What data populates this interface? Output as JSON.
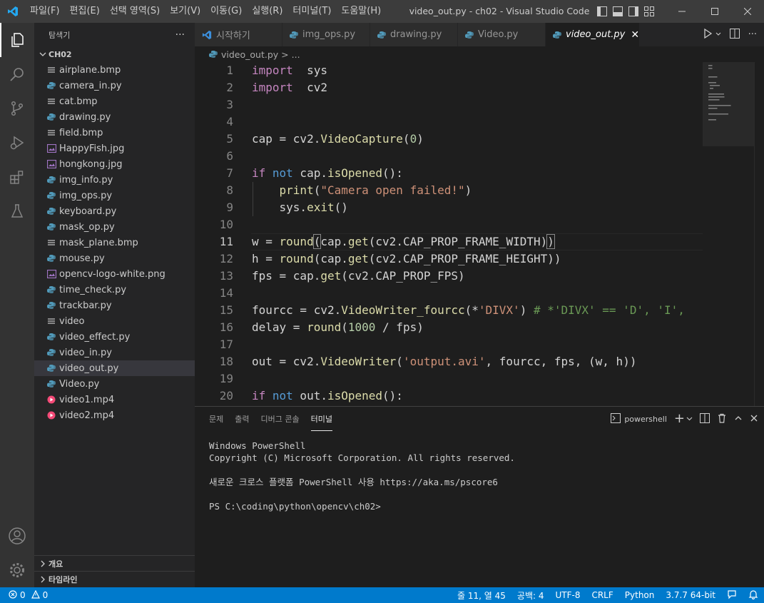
{
  "menu": [
    "파일(F)",
    "편집(E)",
    "선택 영역(S)",
    "보기(V)",
    "이동(G)",
    "실행(R)",
    "터미널(T)",
    "도움말(H)"
  ],
  "window_title": "video_out.py - ch02 - Visual Studio Code",
  "sidebar": {
    "title": "탐색기",
    "more": "···",
    "folder": "CH02",
    "files": [
      {
        "name": "airplane.bmp",
        "type": "plain"
      },
      {
        "name": "camera_in.py",
        "type": "python"
      },
      {
        "name": "cat.bmp",
        "type": "plain"
      },
      {
        "name": "drawing.py",
        "type": "python"
      },
      {
        "name": "field.bmp",
        "type": "plain"
      },
      {
        "name": "HappyFish.jpg",
        "type": "image"
      },
      {
        "name": "hongkong.jpg",
        "type": "image"
      },
      {
        "name": "img_info.py",
        "type": "python"
      },
      {
        "name": "img_ops.py",
        "type": "python"
      },
      {
        "name": "keyboard.py",
        "type": "python"
      },
      {
        "name": "mask_op.py",
        "type": "python"
      },
      {
        "name": "mask_plane.bmp",
        "type": "plain"
      },
      {
        "name": "mouse.py",
        "type": "python"
      },
      {
        "name": "opencv-logo-white.png",
        "type": "image"
      },
      {
        "name": "time_check.py",
        "type": "python"
      },
      {
        "name": "trackbar.py",
        "type": "python"
      },
      {
        "name": "video",
        "type": "plain"
      },
      {
        "name": "video_effect.py",
        "type": "python"
      },
      {
        "name": "video_in.py",
        "type": "python"
      },
      {
        "name": "video_out.py",
        "type": "python"
      },
      {
        "name": "Video.py",
        "type": "python"
      },
      {
        "name": "video1.mp4",
        "type": "video"
      },
      {
        "name": "video2.mp4",
        "type": "video"
      }
    ],
    "selected_file": "video_out.py",
    "outline": "개요",
    "timeline": "타임라인"
  },
  "tabs": [
    {
      "label": "시작하기",
      "icon": "vscode-logo-icon",
      "active": false
    },
    {
      "label": "img_ops.py",
      "icon": "python-file-icon",
      "active": false
    },
    {
      "label": "drawing.py",
      "icon": "python-file-icon",
      "active": false
    },
    {
      "label": "Video.py",
      "icon": "python-file-icon",
      "active": false
    },
    {
      "label": "video_out.py",
      "icon": "python-file-icon",
      "active": true
    }
  ],
  "breadcrumb": {
    "file": "video_out.py",
    "trail": ">",
    "ellipsis": "..."
  },
  "editor": {
    "current_line": 11,
    "lines": [
      {
        "n": "1",
        "tokens": [
          [
            "kwc",
            "import"
          ],
          [
            "",
            "  sys"
          ]
        ]
      },
      {
        "n": "2",
        "tokens": [
          [
            "kwc",
            "import"
          ],
          [
            "",
            "  cv2"
          ]
        ]
      },
      {
        "n": "3",
        "tokens": []
      },
      {
        "n": "4",
        "tokens": []
      },
      {
        "n": "5",
        "tokens": [
          [
            "",
            "cap = cv2."
          ],
          [
            "fn",
            "VideoCapture"
          ],
          [
            "",
            "("
          ],
          [
            "num",
            "0"
          ],
          [
            "",
            ")"
          ]
        ]
      },
      {
        "n": "6",
        "tokens": []
      },
      {
        "n": "7",
        "tokens": [
          [
            "kwc",
            "if"
          ],
          [
            "",
            ""
          ],
          [
            "kw",
            " not"
          ],
          [
            "",
            " cap."
          ],
          [
            "fn",
            "isOpened"
          ],
          [
            "",
            "():"
          ]
        ]
      },
      {
        "n": "8",
        "tokens": [
          [
            "",
            "    "
          ],
          [
            "fn",
            "print"
          ],
          [
            "",
            "("
          ],
          [
            "str",
            "\"Camera open failed!\""
          ],
          [
            "",
            ")"
          ]
        ]
      },
      {
        "n": "9",
        "tokens": [
          [
            "",
            "    sys."
          ],
          [
            "fn",
            "exit"
          ],
          [
            "",
            "()"
          ]
        ]
      },
      {
        "n": "10",
        "tokens": []
      },
      {
        "n": "11",
        "tokens": [
          [
            "",
            "w = "
          ],
          [
            "fn",
            "round"
          ],
          [
            "hl",
            "("
          ],
          [
            "",
            "cap."
          ],
          [
            "fn",
            "get"
          ],
          [
            "",
            "(cv2.CAP_PROP_FRAME_WIDTH)"
          ],
          [
            "hl",
            ")"
          ]
        ]
      },
      {
        "n": "12",
        "tokens": [
          [
            "",
            "h = "
          ],
          [
            "fn",
            "round"
          ],
          [
            "",
            "(cap."
          ],
          [
            "fn",
            "get"
          ],
          [
            "",
            "(cv2.CAP_PROP_FRAME_HEIGHT))"
          ]
        ]
      },
      {
        "n": "13",
        "tokens": [
          [
            "",
            "fps = cap."
          ],
          [
            "fn",
            "get"
          ],
          [
            "",
            "(cv2.CAP_PROP_FPS)"
          ]
        ]
      },
      {
        "n": "14",
        "tokens": []
      },
      {
        "n": "15",
        "tokens": [
          [
            "",
            "fourcc = cv2."
          ],
          [
            "fn",
            "VideoWriter_fourcc"
          ],
          [
            "",
            "(*"
          ],
          [
            "str",
            "'DIVX'"
          ],
          [
            "",
            ") "
          ],
          [
            "cmt",
            "# *'DIVX' == 'D', 'I',"
          ]
        ]
      },
      {
        "n": "16",
        "tokens": [
          [
            "",
            "delay = "
          ],
          [
            "fn",
            "round"
          ],
          [
            "",
            "("
          ],
          [
            "num",
            "1000"
          ],
          [
            "",
            " / fps)"
          ]
        ]
      },
      {
        "n": "17",
        "tokens": []
      },
      {
        "n": "18",
        "tokens": [
          [
            "",
            "out = cv2."
          ],
          [
            "fn",
            "VideoWriter"
          ],
          [
            "",
            "("
          ],
          [
            "str",
            "'output.avi'"
          ],
          [
            "",
            ", fourcc, fps, (w, h))"
          ]
        ]
      },
      {
        "n": "19",
        "tokens": []
      },
      {
        "n": "20",
        "tokens": [
          [
            "kwc",
            "if"
          ],
          [
            "kw",
            " not"
          ],
          [
            "",
            " out."
          ],
          [
            "fn",
            "isOpened"
          ],
          [
            "",
            "():"
          ]
        ]
      }
    ]
  },
  "panel": {
    "tabs": [
      "문제",
      "출력",
      "디버그 콘솔",
      "터미널"
    ],
    "active_tab": "터미널",
    "shell": "powershell",
    "terminal_lines": [
      "Windows PowerShell",
      "Copyright (C) Microsoft Corporation. All rights reserved.",
      "",
      "새로운 크로스 플랫폼 PowerShell 사용 https://aka.ms/pscore6",
      "",
      "PS C:\\coding\\python\\opencv\\ch02>"
    ]
  },
  "status": {
    "errors": "0",
    "warnings": "0",
    "position": "줄 11, 열 45",
    "spaces": "공백: 4",
    "encoding": "UTF-8",
    "eol": "CRLF",
    "language": "Python",
    "interpreter": "3.7.7 64-bit"
  },
  "colors": {
    "accent": "#007acc",
    "python_icon": "#519aba",
    "image_icon": "#a074c4",
    "video_icon": "#f44a77"
  }
}
